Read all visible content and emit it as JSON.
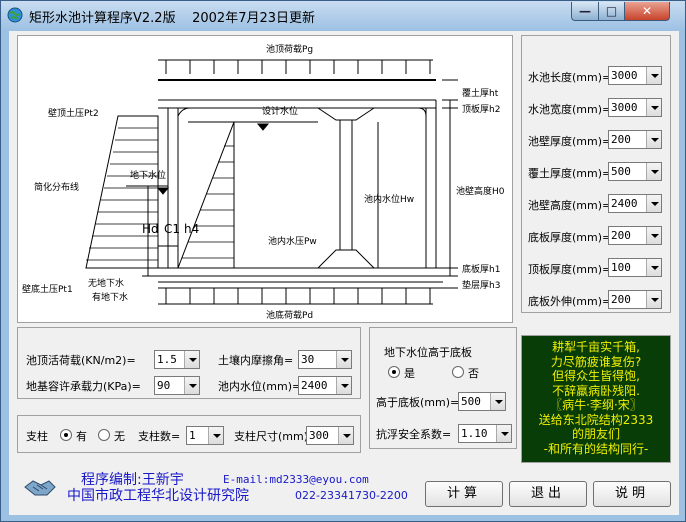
{
  "window": {
    "title": "矩形水池计算程序V2.2版",
    "date": "2002年7月23日更新"
  },
  "drawing": {
    "labels": {
      "pg": "池顶荷载Pg",
      "pt2": "壁顶土压Pt2",
      "design_water": "设计水位",
      "ht": "覆土厚ht",
      "h2": "顶板厚h2",
      "dist": "简化分布线",
      "gw": "地下水位",
      "hw": "池内水位Hw",
      "h0": "池壁高度H0",
      "hd": "Hd",
      "c1": "C1",
      "h4": "h4",
      "pw": "池内水压Pw",
      "h1": "底板厚h1",
      "h3": "垫层厚h3",
      "nogw": "无地下水",
      "hasgw": "有地下水",
      "pt1": "壁底土压Pt1",
      "pd": "池底荷载Pd"
    }
  },
  "params": [
    {
      "label": "水池长度(mm)=",
      "value": "3000"
    },
    {
      "label": "水池宽度(mm)=",
      "value": "3000"
    },
    {
      "label": "池壁厚度(mm)=",
      "value": "200"
    },
    {
      "label": "覆土厚度(mm)=",
      "value": "500"
    },
    {
      "label": "池壁高度(mm)=",
      "value": "2400"
    },
    {
      "label": "底板厚度(mm)=",
      "value": "200"
    },
    {
      "label": "顶板厚度(mm)=",
      "value": "100"
    },
    {
      "label": "底板外伸(mm)=",
      "value": "200"
    }
  ],
  "loads": {
    "top_load_label": "池顶活荷载(KN/m2)=",
    "top_load_value": "1.5",
    "bearing_label": "地基容许承载力(KPa)=",
    "bearing_value": "90",
    "friction_label": "土壤内摩擦角=",
    "friction_value": "30",
    "water_label": "池内水位(mm)=",
    "water_value": "2400"
  },
  "groundwater": {
    "title": "地下水位高于底板",
    "yes_label": "是",
    "no_label": "否",
    "above_label": "高于底板(mm)=",
    "above_value": "500",
    "safety_label": "抗浮安全系数=",
    "safety_value": "1.10"
  },
  "column": {
    "label": "支柱",
    "has_label": "有",
    "none_label": "无",
    "count_label": "支柱数=",
    "count_value": "1",
    "size_label": "支柱尺寸(mm)",
    "size_value": "300"
  },
  "poem": [
    "耕犁千亩实千箱,",
    "力尽筋疲谁复伤?",
    "但得众生皆得饱,",
    "不辞羸病卧残阳.",
    "〖病牛·李纲·宋〗",
    "送给东北院结构2333",
    "的朋友们",
    "-和所有的结构同行-"
  ],
  "footer": {
    "author": "程序编制:王新宇",
    "email": "E-mail:md2333@eyou.com",
    "org": "中国市政工程华北设计研究院",
    "phone": "022-23341730-2200"
  },
  "buttons": {
    "calc": "计算",
    "exit": "退出",
    "help": "说明"
  },
  "colors": {
    "poem_bg": "#083d08",
    "poem_text": "#f0f000",
    "footer_blue": "#1818c8"
  }
}
